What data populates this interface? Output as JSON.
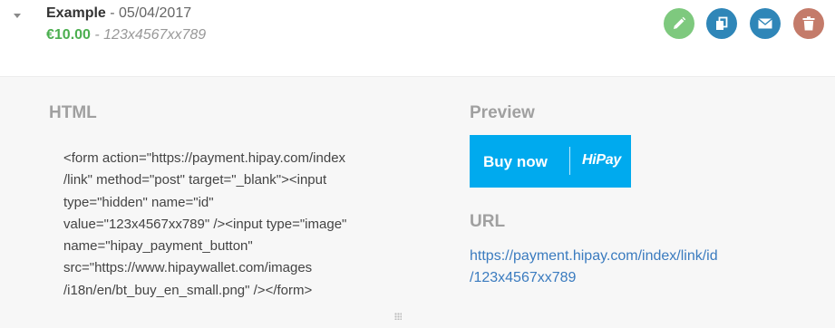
{
  "item": {
    "name": "Example",
    "separator": " - ",
    "date": "05/04/2017",
    "amount": "€10.00",
    "ref_separator": " - ",
    "reference": "123x4567xx789"
  },
  "actions": [
    {
      "name": "edit",
      "icon": "pencil-icon",
      "color": "#7ec97e"
    },
    {
      "name": "duplicate",
      "icon": "copy-icon",
      "color": "#2f86b8"
    },
    {
      "name": "email",
      "icon": "envelope-icon",
      "color": "#2f86b8"
    },
    {
      "name": "delete",
      "icon": "trash-icon",
      "color": "#c47b6a"
    }
  ],
  "html_section": {
    "title": "HTML",
    "code": "<form action=\"https://payment.hipay.com/index\n/link\" method=\"post\" target=\"_blank\"><input\ntype=\"hidden\" name=\"id\"\nvalue=\"123x4567xx789\" /><input type=\"image\"\nname=\"hipay_payment_button\"\nsrc=\"https://www.hipaywallet.com/images\n/i18n/en/bt_buy_en_small.png\" /></form>"
  },
  "preview_section": {
    "title": "Preview",
    "button_label": "Buy now",
    "brand": "HiPay"
  },
  "url_section": {
    "title": "URL",
    "link": "https://payment.hipay.com/index/link/id\n/123x4567xx789"
  }
}
